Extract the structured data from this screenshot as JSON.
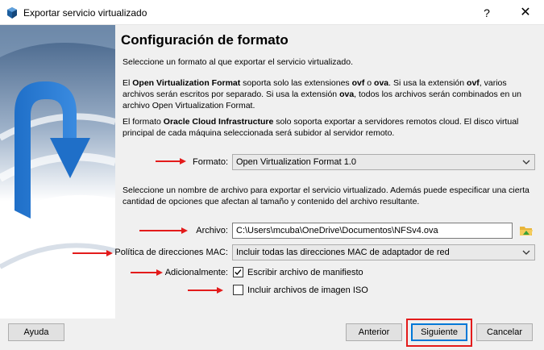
{
  "window": {
    "title": "Exportar servicio virtualizado",
    "help": "?",
    "close": "✕"
  },
  "page": {
    "title": "Configuración de formato",
    "intro": "Seleccione un formato al que exportar el servicio virtualizado.",
    "ovf_p1": "El ",
    "ovf_strong": "Open Virtualization Format",
    "ovf_p2": " soporta solo las extensiones ",
    "ovf_ext1": "ovf",
    "ovf_p3": " o ",
    "ovf_ext2": "ova",
    "ovf_p4": ". Si usa la extensión ",
    "ovf_ext3": "ovf",
    "ovf_p5": ", varios archivos serán escritos por separado. Si usa la extensión ",
    "ovf_ext4": "ova",
    "ovf_p6": ", todos los archivos serán combinados en un archivo Open Virtualization Format.",
    "oci_p1": "El formato ",
    "oci_strong": "Oracle Cloud Infrastructure",
    "oci_p2": " solo soporta exportar a servidores remotos cloud. El disco virtual principal de cada máquina seleccionada será subidor al servidor remoto.",
    "file_intro": "Seleccione un nombre de archivo para exportar el servicio virtualizado. Además puede especificar una cierta cantidad de opciones que afectan al tamaño y contenido del archivo resultante."
  },
  "form": {
    "format_label": "Formato:",
    "format_value": "Open Virtualization Format 1.0",
    "file_label": "Archivo:",
    "file_value": "C:\\Users\\mcuba\\OneDrive\\Documentos\\NFSv4.ova",
    "mac_label": "Política de direcciones MAC:",
    "mac_value": "Incluir todas las direcciones MAC de adaptador de red",
    "additional_label": "Adicionalmente:",
    "manifest_label": "Escribir archivo de manifiesto",
    "manifest_checked": true,
    "iso_label": "Incluir archivos de imagen ISO",
    "iso_checked": false
  },
  "buttons": {
    "help": "Ayuda",
    "back": "Anterior",
    "next": "Siguiente",
    "cancel": "Cancelar"
  },
  "colors": {
    "annotation_red": "#e31b1b",
    "dialog_bg": "#f0f0f0",
    "accent_blue": "#0078d7"
  },
  "icons": {
    "app": "virtualbox-icon",
    "folder": "folder-open-icon",
    "chevron": "chevron-down-icon"
  }
}
